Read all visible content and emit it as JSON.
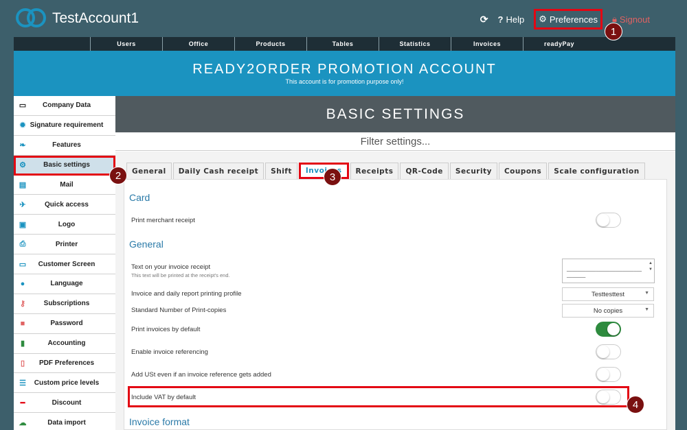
{
  "header": {
    "account_name": "TestAccount1",
    "actions": {
      "help": "Help",
      "preferences": "Preferences",
      "signout": "Signout"
    }
  },
  "main_nav": [
    "Users",
    "Office",
    "Products",
    "Tables",
    "Statistics",
    "Invoices",
    "readyPay"
  ],
  "banner": {
    "title": "READY2ORDER PROMOTION ACCOUNT",
    "subtitle": "This account is for promotion purpose only!"
  },
  "sidebar": {
    "items": [
      {
        "label": "Company Data",
        "icon": "credit-card-icon"
      },
      {
        "label": "Signature requirement",
        "icon": "badge-icon"
      },
      {
        "label": "Features",
        "icon": "leaf-icon"
      },
      {
        "label": "Basic settings",
        "icon": "gears-icon",
        "active": true
      },
      {
        "label": "Mail",
        "icon": "inbox-icon"
      },
      {
        "label": "Quick access",
        "icon": "plane-icon"
      },
      {
        "label": "Logo",
        "icon": "image-icon"
      },
      {
        "label": "Printer",
        "icon": "printer-icon"
      },
      {
        "label": "Customer Screen",
        "icon": "monitor-icon"
      },
      {
        "label": "Language",
        "icon": "globe-icon"
      },
      {
        "label": "Subscriptions",
        "icon": "key-icon"
      },
      {
        "label": "Password",
        "icon": "lock-icon"
      },
      {
        "label": "Accounting",
        "icon": "bookmark-icon"
      },
      {
        "label": "PDF Preferences",
        "icon": "pdf-icon"
      },
      {
        "label": "Custom price levels",
        "icon": "list-icon"
      },
      {
        "label": "Discount",
        "icon": "minus-icon"
      },
      {
        "label": "Data import",
        "icon": "cloud-upload-icon"
      }
    ]
  },
  "content": {
    "heading": "BASIC SETTINGS",
    "filter_placeholder": "Filter settings...",
    "tabs": [
      "General",
      "Daily Cash receipt",
      "Shift",
      "Invoices",
      "Receipts",
      "QR-Code",
      "Security",
      "Coupons",
      "Scale configuration"
    ],
    "active_tab": "Invoices",
    "sections": {
      "card": "Card",
      "general": "General",
      "invoice_format": "Invoice format"
    },
    "rows": {
      "print_merchant_receipt": {
        "label": "Print merchant receipt",
        "on": false
      },
      "invoice_text": {
        "label": "Text on your invoice receipt",
        "hint": "This text will be printed at the receipt's end.",
        "value": "___________________________________"
      },
      "printing_profile": {
        "label": "Invoice and daily report printing profile",
        "value": "Testtesttest"
      },
      "print_copies": {
        "label": "Standard Number of Print-copies",
        "value": "No copies"
      },
      "print_by_default": {
        "label": "Print invoices by default",
        "on": true
      },
      "invoice_referencing": {
        "label": "Enable invoice referencing",
        "on": false
      },
      "add_ust": {
        "label": "Add USt even if an invoice reference gets added",
        "on": false
      },
      "include_vat": {
        "label": "Include VAT by default",
        "on": false
      }
    }
  },
  "callouts": [
    "1",
    "2",
    "3",
    "4"
  ],
  "colors": {
    "accent_red": "#e30613",
    "brand_blue": "#1b93c0",
    "toggle_on": "#2e8b3e"
  }
}
